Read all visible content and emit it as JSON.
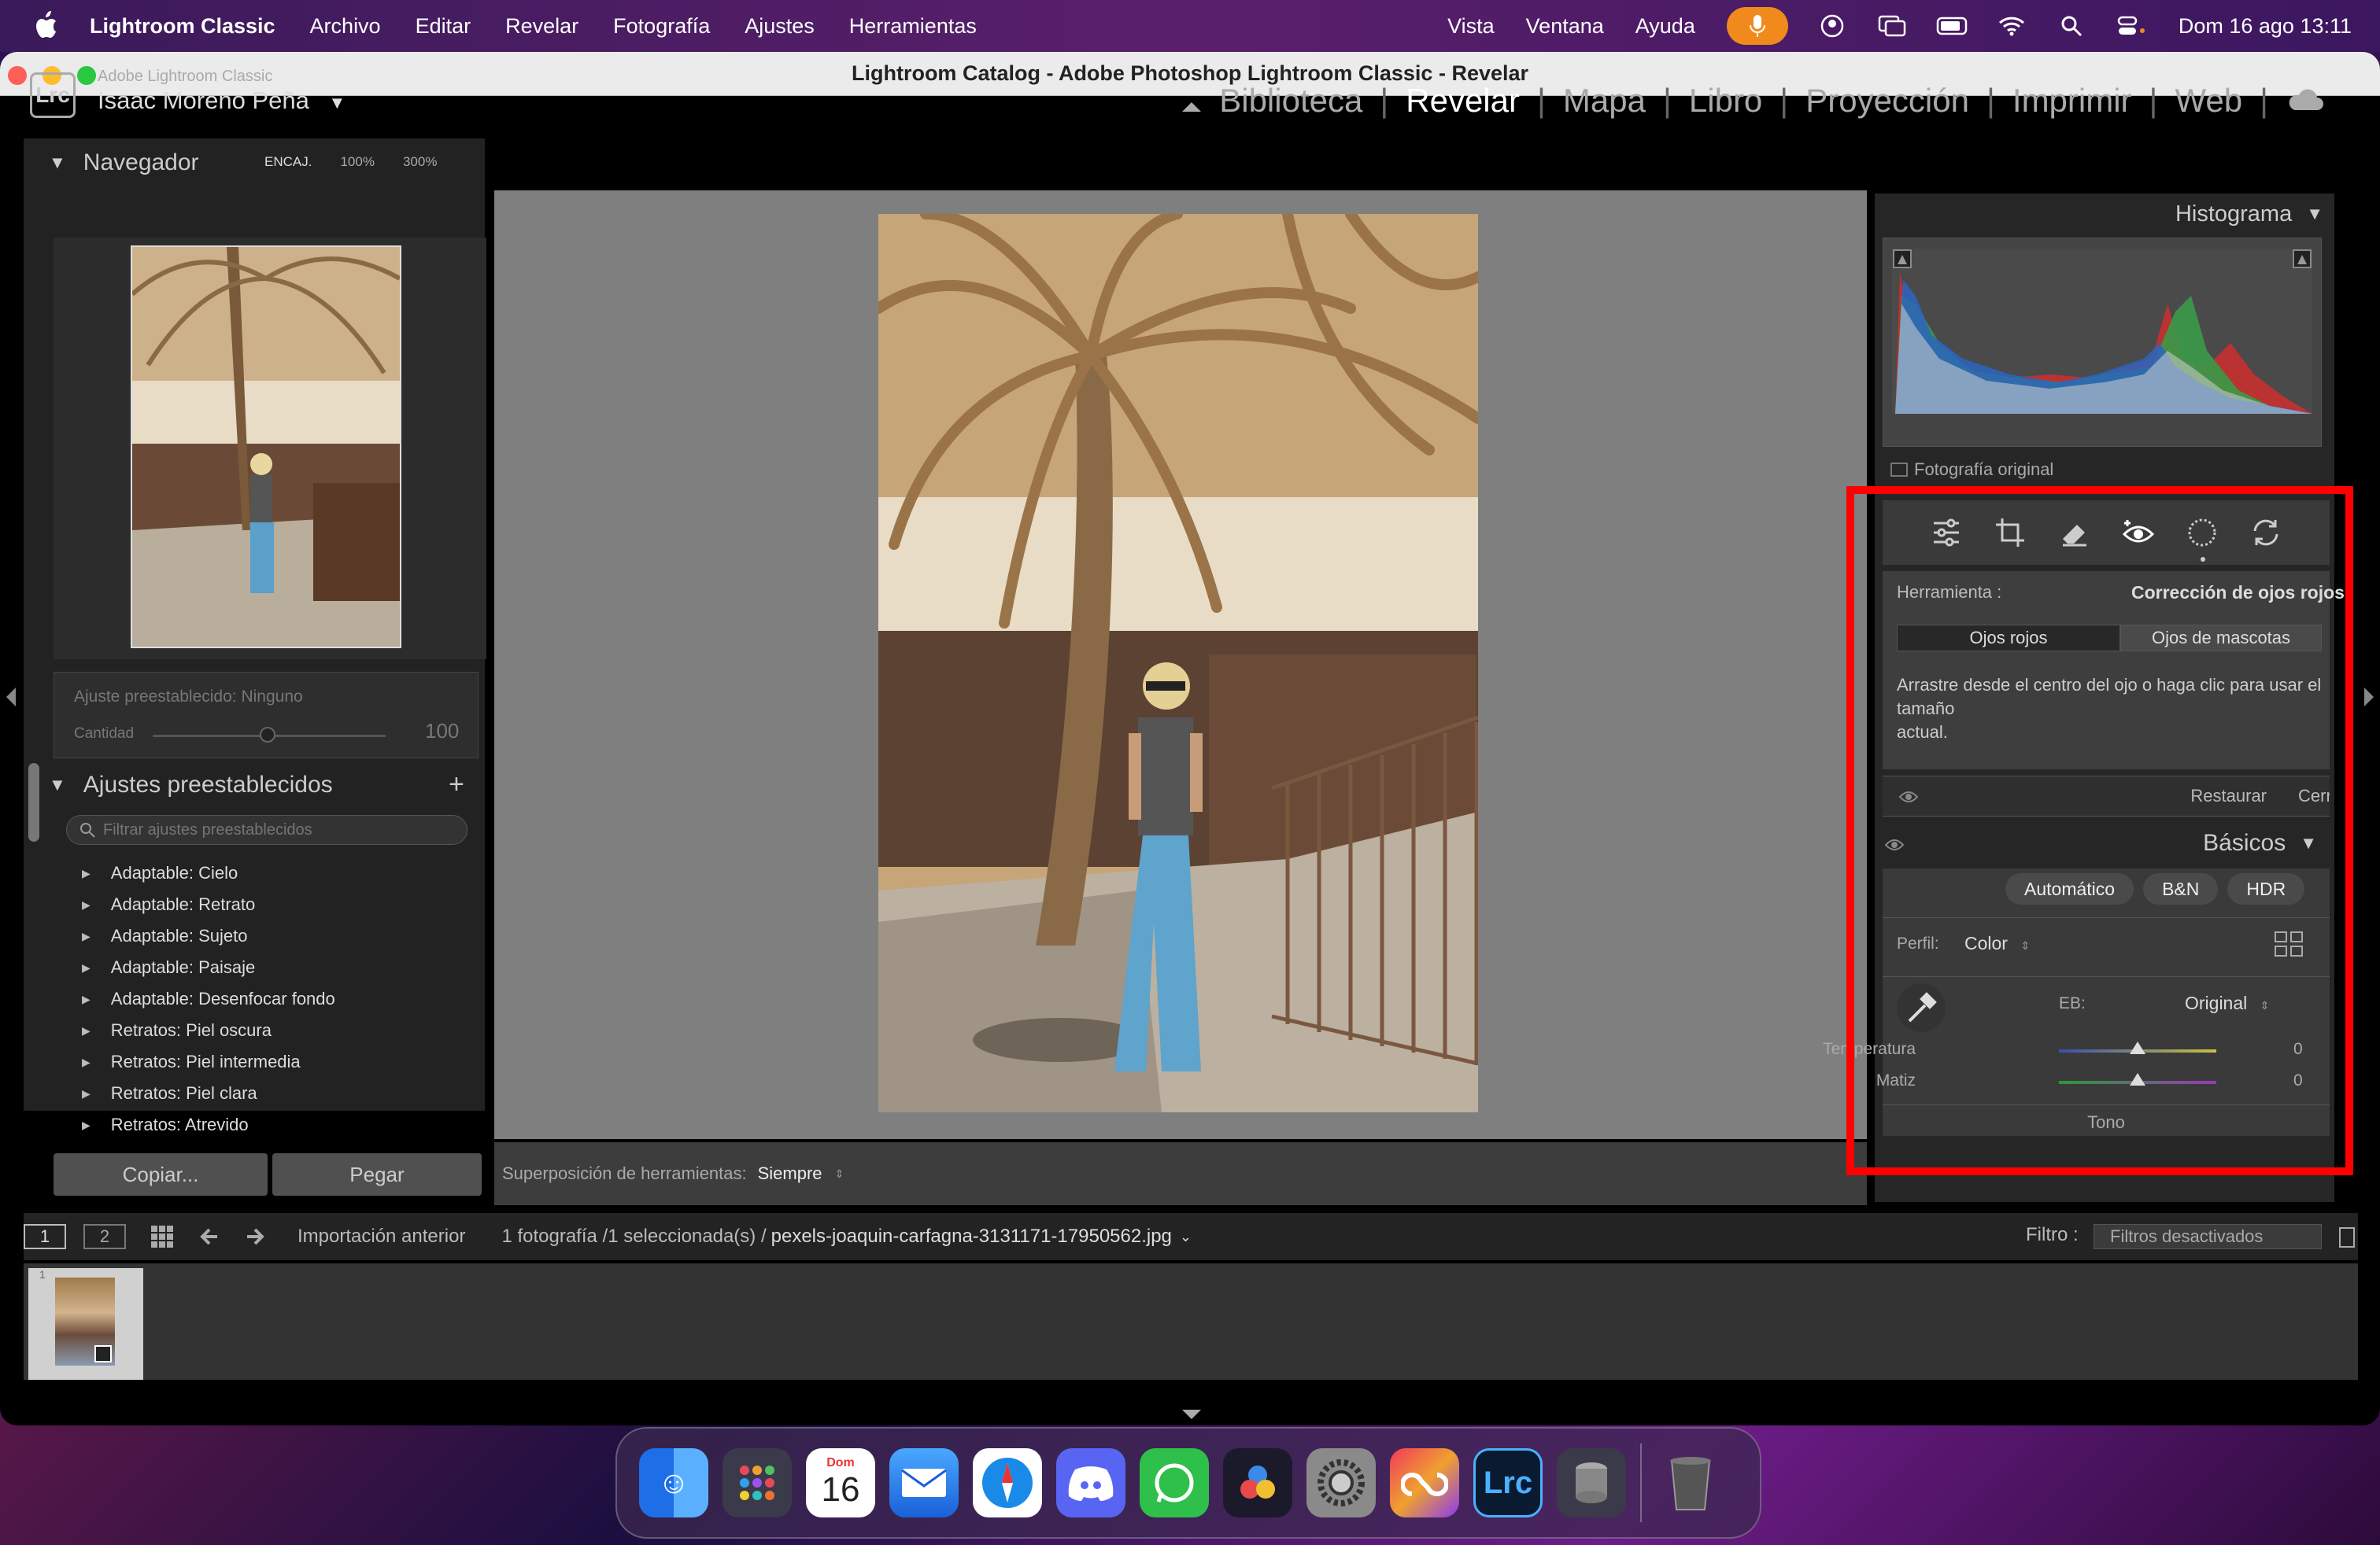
{
  "menubar": {
    "app_name": "Lightroom Classic",
    "items": [
      "Archivo",
      "Editar",
      "Revelar",
      "Fotografía",
      "Ajustes",
      "Herramientas"
    ],
    "right_items": [
      "Vista",
      "Ventana",
      "Ayuda"
    ],
    "clock": "Dom 16 ago 13:11"
  },
  "window": {
    "title": "Lightroom Catalog - Adobe Photoshop Lightroom Classic - Revelar"
  },
  "identity": {
    "logo": "Lrc",
    "product": "Adobe Lightroom Classic",
    "user": "Isaac Moreno Peña",
    "user_arrow": "▼"
  },
  "modules": [
    "Biblioteca",
    "Revelar",
    "Mapa",
    "Libro",
    "Proyección",
    "Imprimir",
    "Web"
  ],
  "active_module": "Revelar",
  "navigator": {
    "title": "Navegador",
    "zoom_fit": "ENCAJ.",
    "zoom_100": "100%",
    "zoom_300": "300%"
  },
  "preset_amount": {
    "label": "Ajuste preestablecido: Ninguno",
    "amount_label": "Cantidad",
    "amount_value": "100"
  },
  "presets": {
    "title": "Ajustes preestablecidos",
    "add": "+",
    "filter_placeholder": "Filtrar ajustes preestablecidos",
    "items": [
      "Adaptable: Cielo",
      "Adaptable: Retrato",
      "Adaptable: Sujeto",
      "Adaptable: Paisaje",
      "Adaptable: Desenfocar fondo",
      "Retratos: Piel oscura",
      "Retratos: Piel intermedia",
      "Retratos: Piel clara",
      "Retratos: Atrevido"
    ]
  },
  "left_buttons": {
    "copy": "Copiar...",
    "paste": "Pegar"
  },
  "toolbar": {
    "overlay_label": "Superposición de herramientas:",
    "overlay_value": "Siempre"
  },
  "histogram": {
    "title": "Histograma",
    "original_photo": "Fotografía original"
  },
  "tools": {
    "tool_label": "Herramienta :",
    "tool_value": "Corrección de ojos rojos",
    "tab_red_eye": "Ojos rojos",
    "tab_pet_eye": "Ojos de mascotas",
    "instructions_1": "Arrastre desde el centro del ojo o haga clic para usar el",
    "instructions_2": "tamaño",
    "instructions_3": "actual.",
    "reset": "Restaurar",
    "close": "Cerrar"
  },
  "basics": {
    "title": "Básicos",
    "auto": "Automático",
    "bw": "B&N",
    "hdr": "HDR",
    "profile_label": "Perfil:",
    "profile_value": "Color",
    "wb_label": "EB:",
    "wb_value": "Original",
    "temp_label": "Temperatura",
    "temp_value": "0",
    "tint_label": "Matiz",
    "tint_value": "0",
    "tone": "Tono"
  },
  "filmstrip": {
    "page1": "1",
    "page2": "2",
    "source": "Importación anterior",
    "count": "1 fotografía /1 seleccionada(s) /",
    "filename": "pexels-joaquin-carfagna-3131171-17950562.jpg",
    "filter_label": "Filtro :",
    "filter_value": "Filtros desactivados",
    "thumb_number": "1"
  },
  "dock": {
    "calendar_month": "Dom",
    "calendar_day": "16",
    "lrc_label": "Lrc"
  },
  "colors": {
    "highlight": "#ff0000",
    "mic": "#f08a1c"
  }
}
